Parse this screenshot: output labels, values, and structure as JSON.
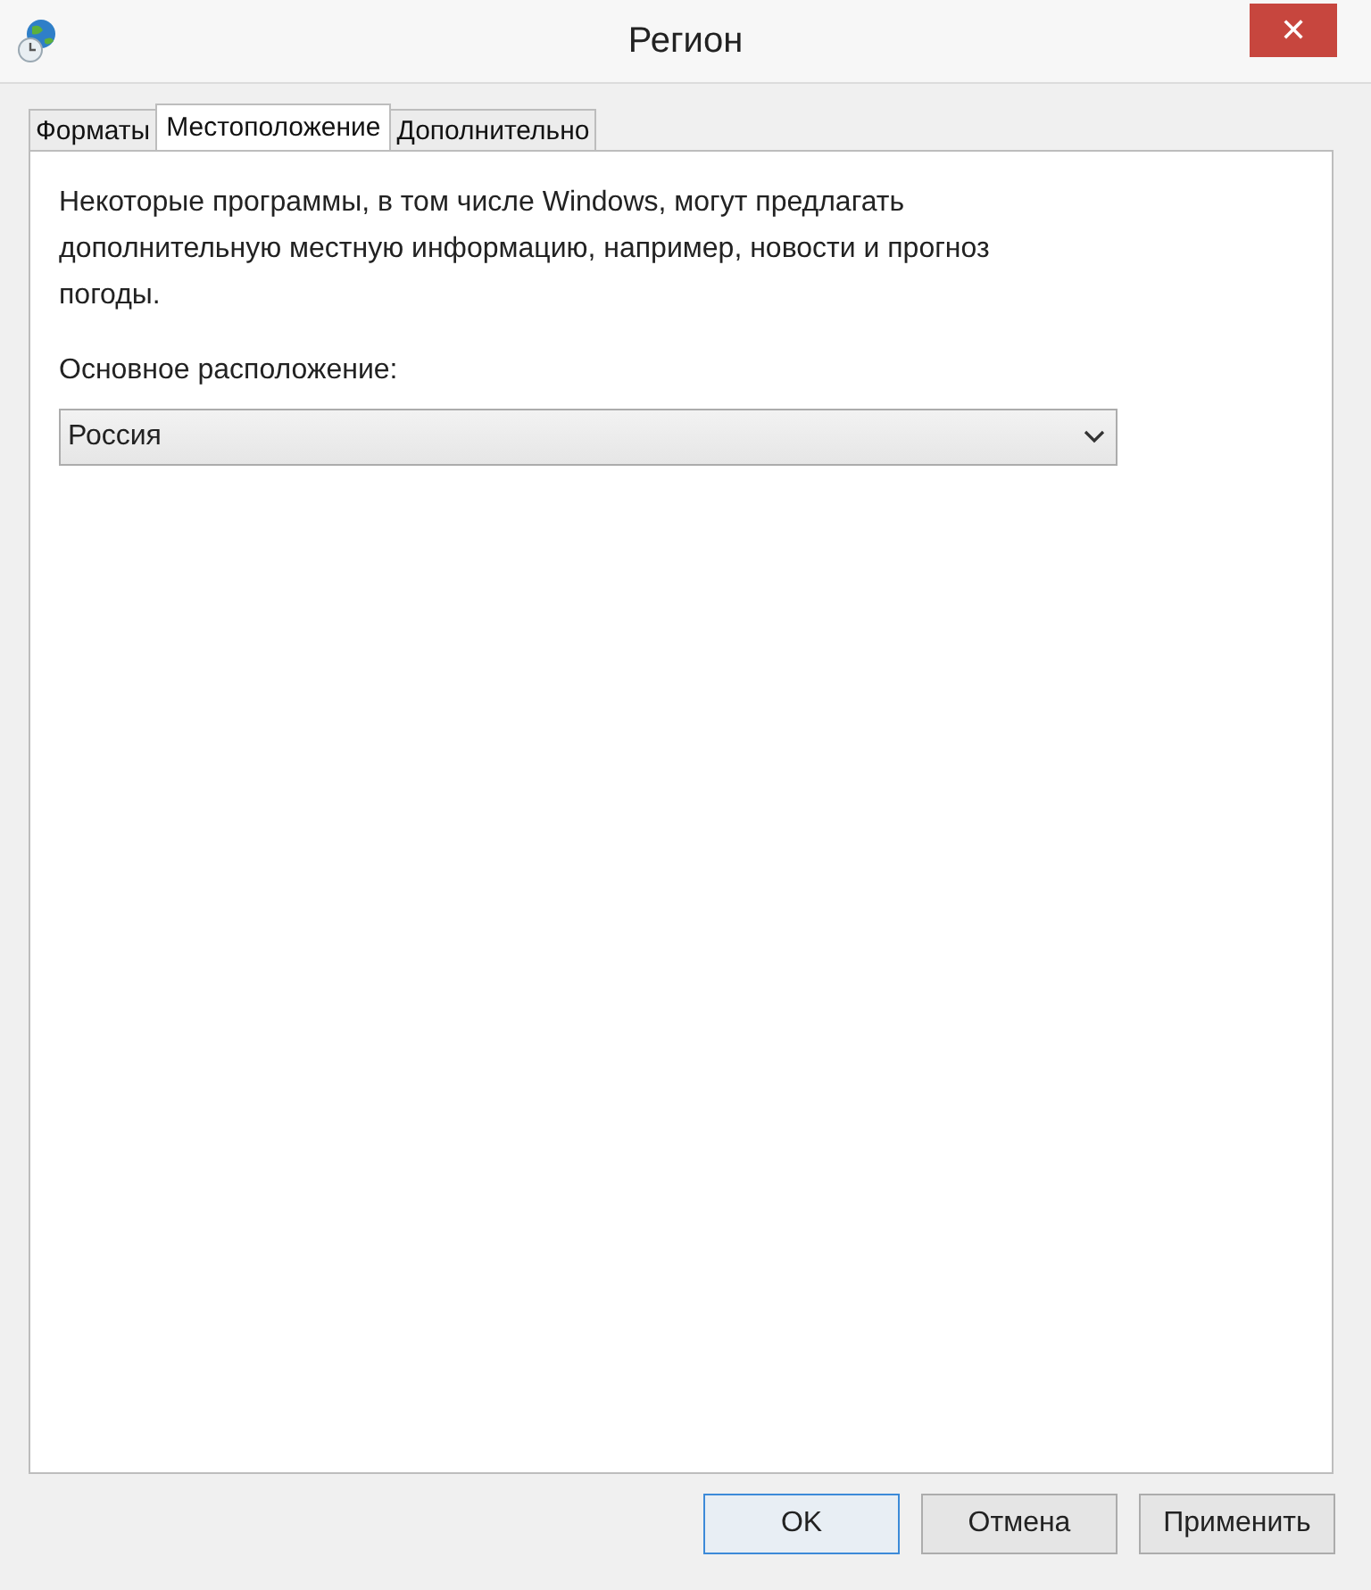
{
  "window": {
    "title": "Регион",
    "close": "✕"
  },
  "tabs": [
    {
      "label": "Форматы",
      "selected": false
    },
    {
      "label": "Местоположение",
      "selected": true
    },
    {
      "label": "Дополнительно",
      "selected": false
    }
  ],
  "description": "Некоторые программы, в том числе Windows, могут предлагать дополнительную местную информацию, например, новости и прогноз погоды.",
  "location": {
    "label": "Основное расположение:",
    "value": "Россия"
  },
  "buttons": [
    {
      "label": "OK",
      "default": true
    },
    {
      "label": "Отмена",
      "default": false
    },
    {
      "label": "Применить",
      "default": false
    }
  ]
}
